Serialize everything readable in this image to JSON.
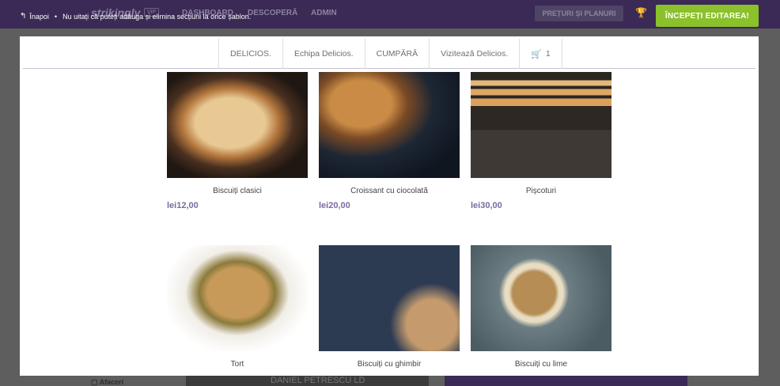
{
  "app": {
    "logo": "strikingly",
    "vip_badge": "VIP",
    "nav": [
      "DASHBOARD",
      "DESCOPERĂ",
      "ADMIN"
    ],
    "pricing_label": "PREȚURI ȘI PLANURI",
    "start_button": "ÎNCEPEȚI EDITAREA!",
    "back_label": "Înapoi",
    "hint": "Nu uitați că puteți adăuga și elimina secțiuni la orice șablon.",
    "bottom_left_label": "Afaceri",
    "bottom_card_text": "DANIEL PETRESCU LD"
  },
  "site_nav": {
    "items": [
      "DELICIOS.",
      "Echipa Delicios.",
      "CUMPĂRĂ",
      "Vizitează Delicios."
    ],
    "cart_count": "1"
  },
  "products": [
    {
      "name": "Biscuiți clasici",
      "price": "lei12,00",
      "image": "bread-loaf"
    },
    {
      "name": "Croissant cu ciocolată",
      "price": "lei20,00",
      "image": "croissant"
    },
    {
      "name": "Pișcoturi",
      "price": "lei30,00",
      "image": "ladyfingers"
    },
    {
      "name": "Tort",
      "price": "",
      "image": "tart"
    },
    {
      "name": "Biscuiți cu ghimbir",
      "price": "",
      "image": "ginger-cookies"
    },
    {
      "name": "Biscuiți cu lime",
      "price": "",
      "image": "lime-cookies"
    }
  ]
}
